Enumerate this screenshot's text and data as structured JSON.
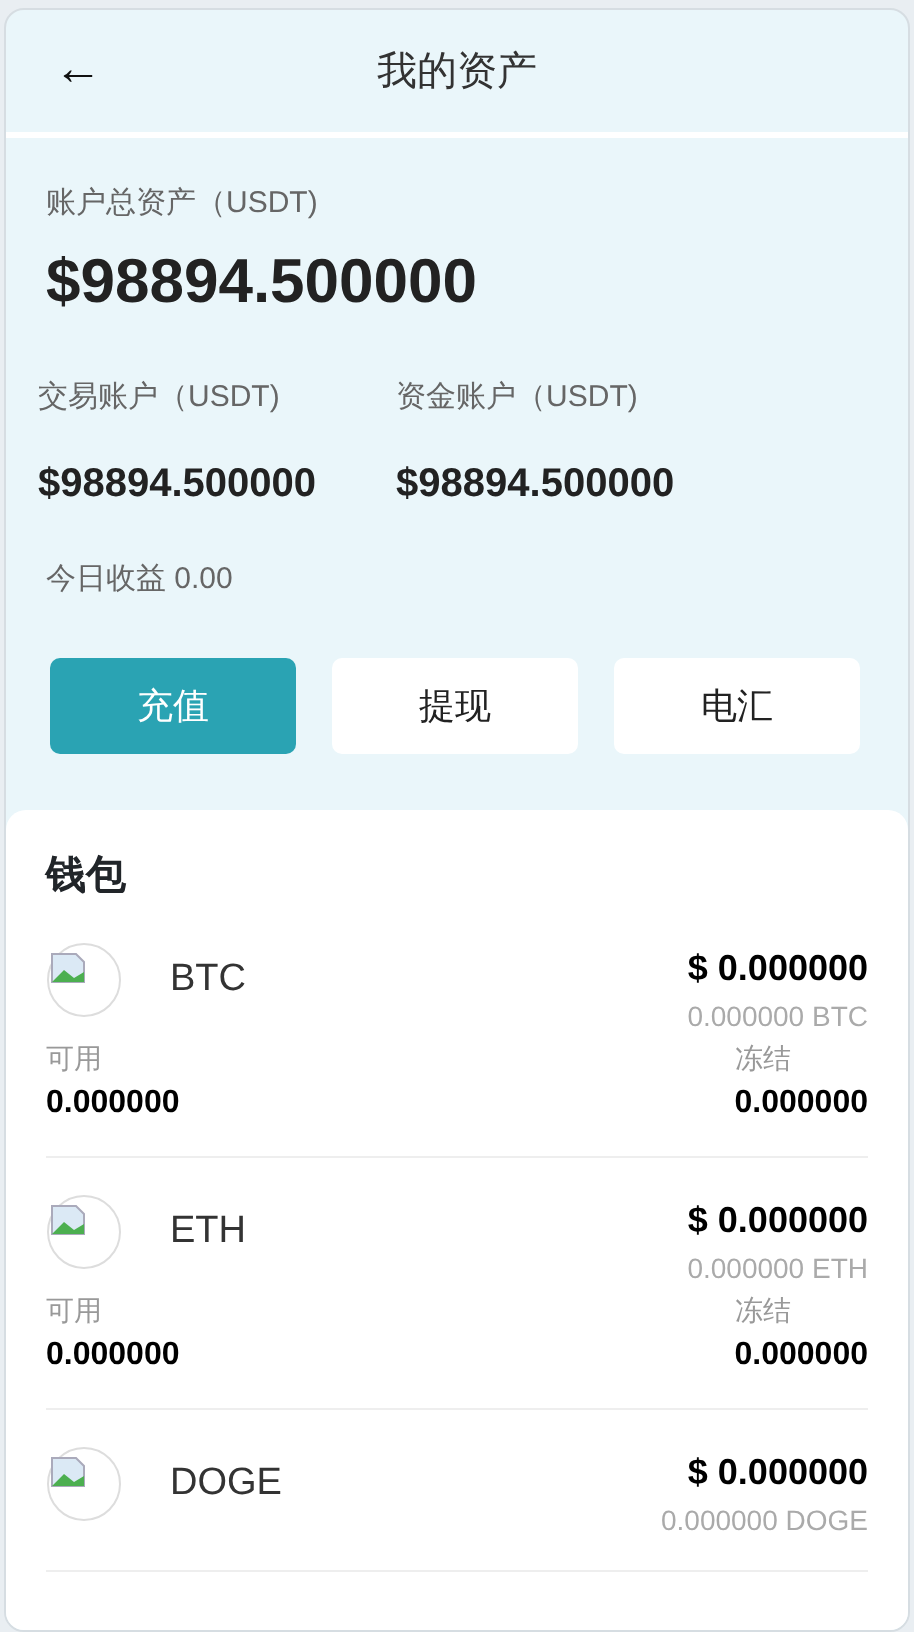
{
  "header": {
    "back": "←",
    "title": "我的资产"
  },
  "total": {
    "label": "账户总资产（USDT)",
    "value": "$98894.500000"
  },
  "accounts": [
    {
      "label": "交易账户（USDT)",
      "value": "$98894.500000"
    },
    {
      "label": "资金账户（USDT)",
      "value": "$98894.500000"
    }
  ],
  "today": "今日收益 0.00",
  "actions": [
    {
      "label": "充值",
      "selected": true
    },
    {
      "label": "提现",
      "selected": false
    },
    {
      "label": "电汇",
      "selected": false
    }
  ],
  "wallet": {
    "title": "钱包",
    "coins": [
      {
        "name": "BTC",
        "usd": "$ 0.000000",
        "amount": "0.000000 BTC",
        "available_label": "可用",
        "available": "0.000000",
        "frozen_label": "冻结",
        "frozen": "0.000000"
      },
      {
        "name": "ETH",
        "usd": "$ 0.000000",
        "amount": "0.000000 ETH",
        "available_label": "可用",
        "available": "0.000000",
        "frozen_label": "冻结",
        "frozen": "0.000000"
      },
      {
        "name": "DOGE",
        "usd": "$ 0.000000",
        "amount": "0.000000 DOGE"
      }
    ]
  }
}
